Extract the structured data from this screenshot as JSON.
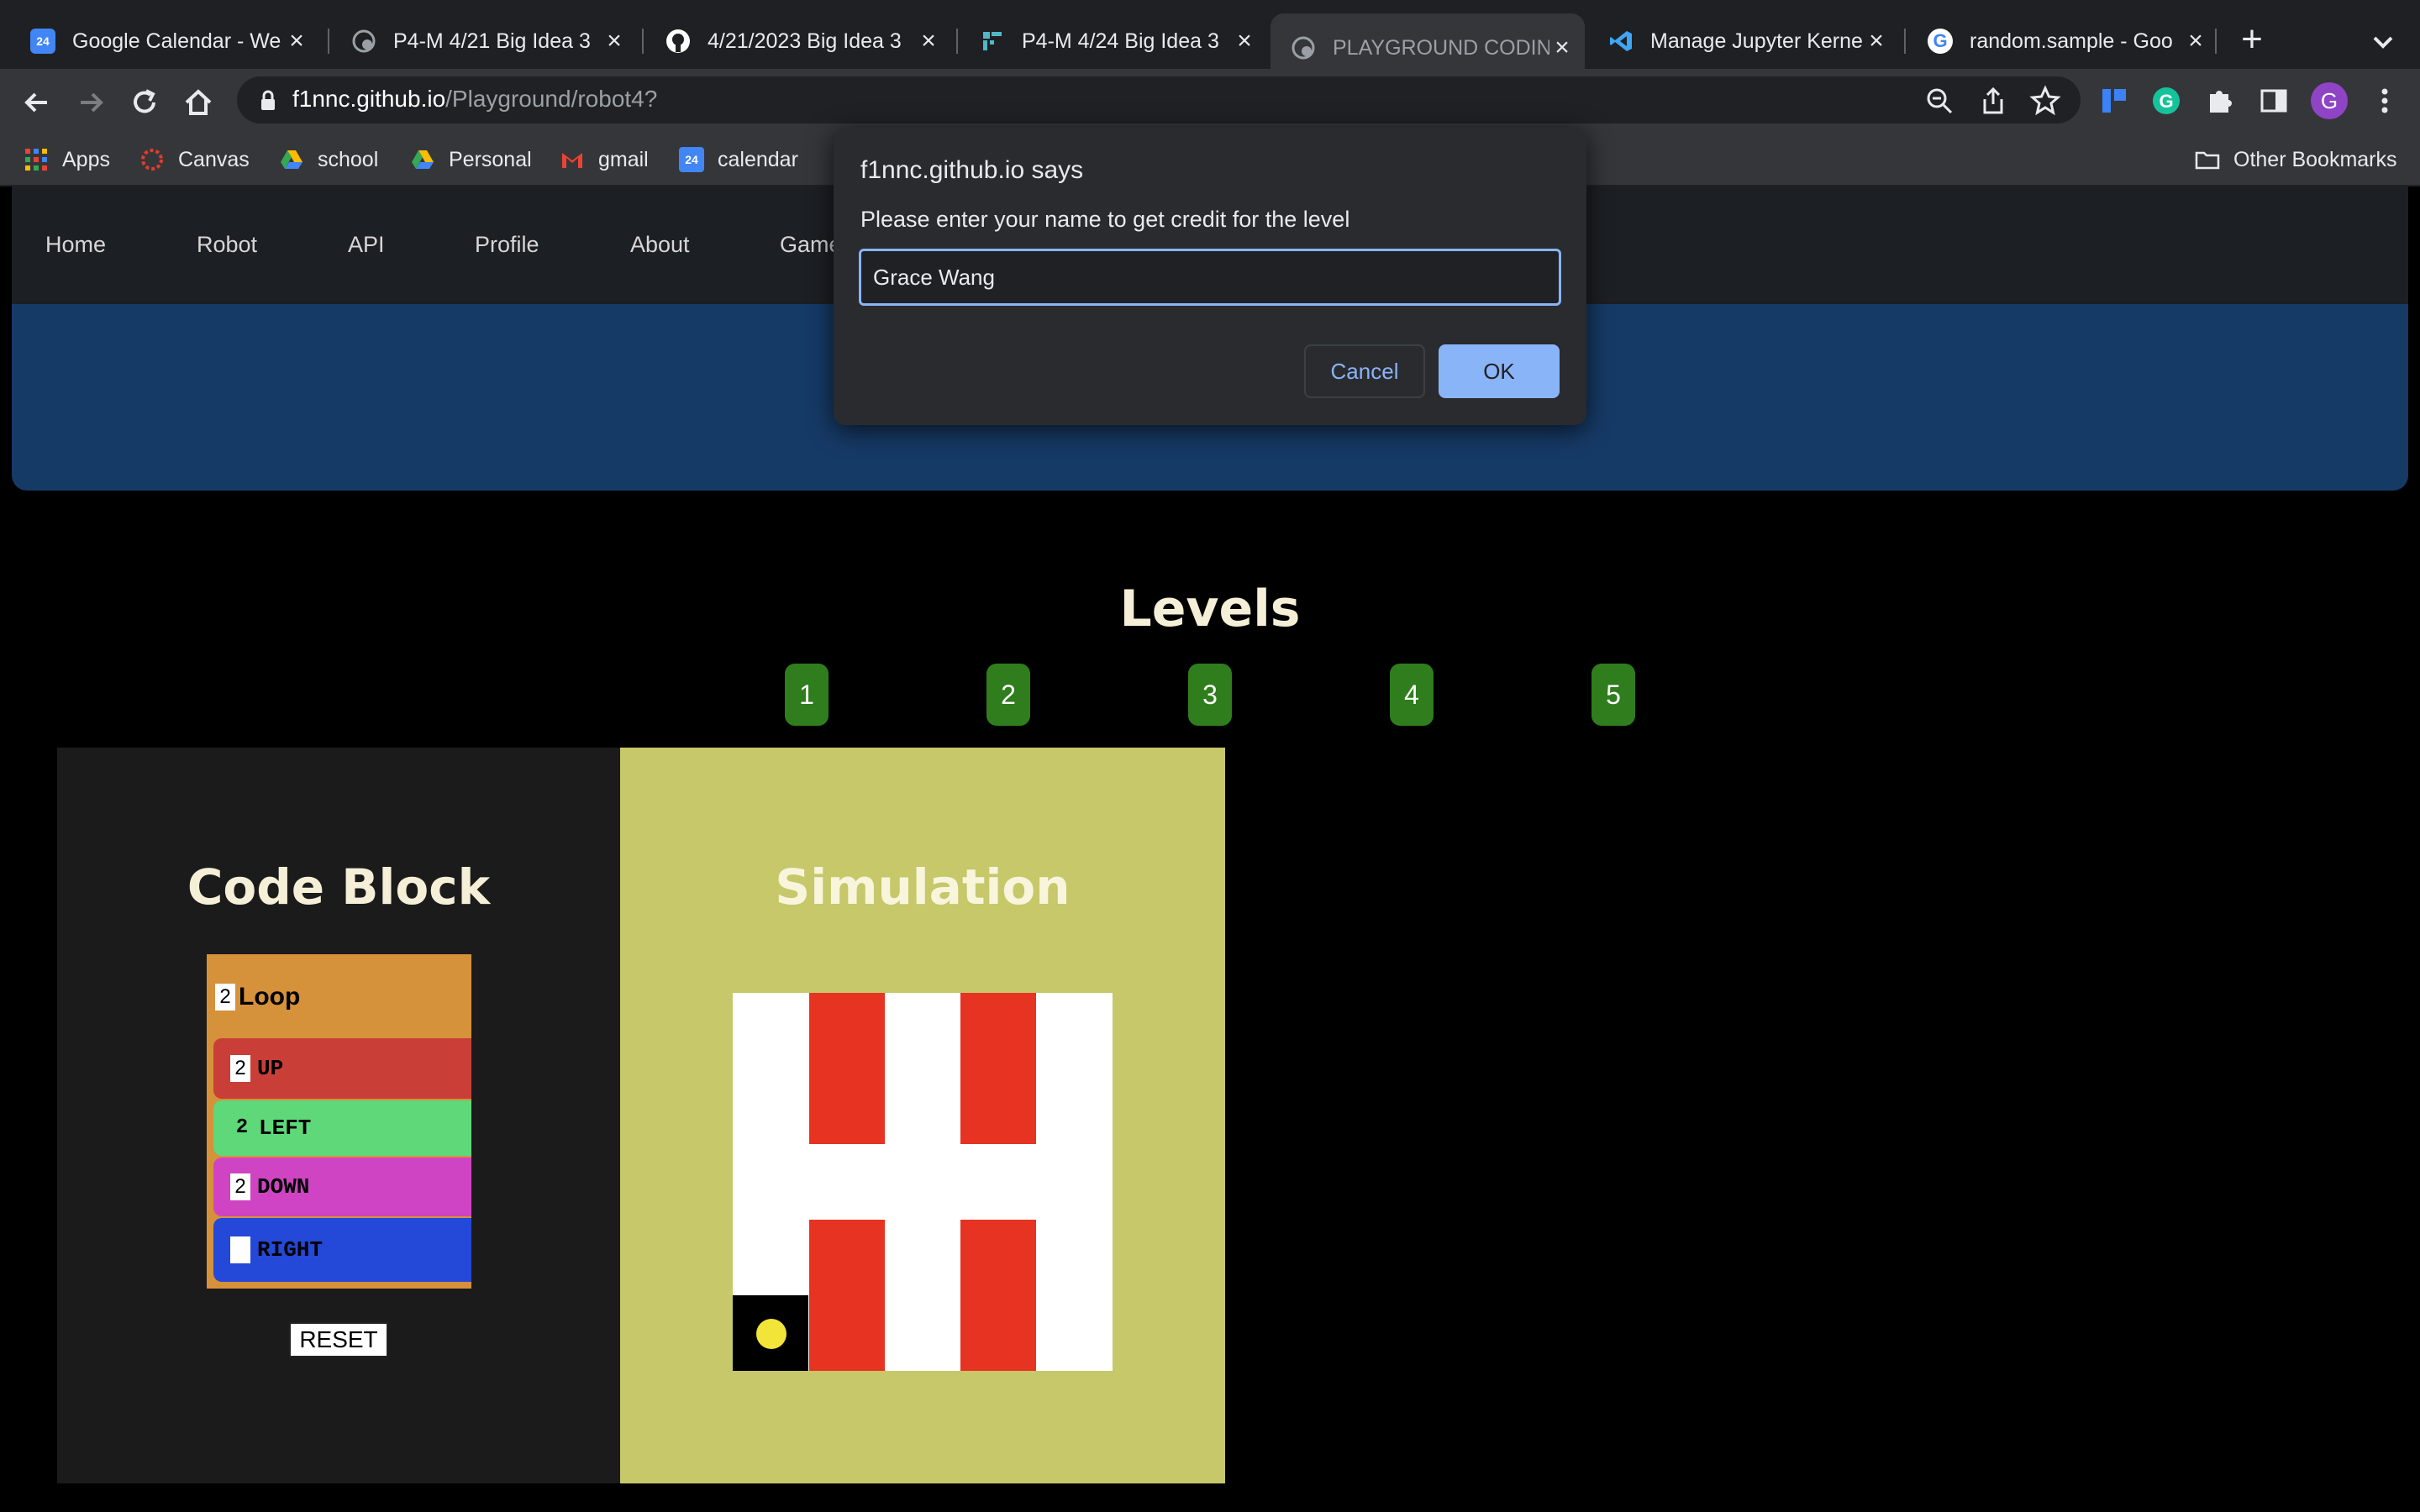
{
  "browser": {
    "tabs": [
      {
        "title": "Google Calendar - We",
        "icon": "google-calendar-icon",
        "color": "#4285f4"
      },
      {
        "title": "P4-M 4/21 Big Idea 3",
        "icon": "globe-icon",
        "color": "#9aa0a6"
      },
      {
        "title": "4/21/2023 Big Idea 3",
        "icon": "github-icon",
        "color": "#ffffff"
      },
      {
        "title": "P4-M 4/24 Big Idea 3",
        "icon": "site-icon",
        "color": "#52b8c8"
      },
      {
        "title": "PLAYGROUND CODIN",
        "icon": "globe-icon",
        "color": "#9aa0a6",
        "active": true
      },
      {
        "title": "Manage Jupyter Kerne",
        "icon": "vscode-icon",
        "color": "#3ea6f5"
      },
      {
        "title": "random.sample - Goo",
        "icon": "google-icon",
        "color": "#4285f4"
      }
    ],
    "url_host": "f1nnc.github.io",
    "url_path": "/Playground/robot4?",
    "profile_initial": "G",
    "bookmarks": [
      {
        "label": "Apps",
        "icon": "apps-grid-icon"
      },
      {
        "label": "Canvas",
        "icon": "canvas-icon"
      },
      {
        "label": "school",
        "icon": "google-drive-icon"
      },
      {
        "label": "Personal",
        "icon": "google-drive-icon"
      },
      {
        "label": "gmail",
        "icon": "gmail-icon"
      },
      {
        "label": "calendar",
        "icon": "google-calendar-icon"
      }
    ],
    "other_bookmarks": "Other Bookmarks"
  },
  "site": {
    "nav": [
      "Home",
      "Robot",
      "API",
      "Profile",
      "About",
      "Games"
    ],
    "levels_title": "Levels",
    "levels": [
      "1",
      "2",
      "3",
      "4",
      "5"
    ],
    "code_block_title": "Code Block",
    "simulation_title": "Simulation",
    "code_rows": [
      {
        "num": "2",
        "label": "Loop"
      },
      {
        "num": "2",
        "label": "UP"
      },
      {
        "num": "2",
        "label": "LEFT"
      },
      {
        "num": "2",
        "label": "DOWN"
      },
      {
        "num": "",
        "label": "RIGHT"
      }
    ],
    "reset_label": "RESET"
  },
  "dialog": {
    "title": "f1nnc.github.io says",
    "message": "Please enter your name to get credit for the level",
    "input_value": "Grace Wang",
    "cancel_label": "Cancel",
    "ok_label": "OK"
  },
  "colors": {
    "loop": "#d6913b",
    "up": "#c93f37",
    "left": "#5fd87a",
    "down": "#cf44c2",
    "right": "#2448d8",
    "wall": "#e63322",
    "robot": "#f3e43a",
    "level_button": "#2f7d1d",
    "accent": "#8ab4f8"
  }
}
